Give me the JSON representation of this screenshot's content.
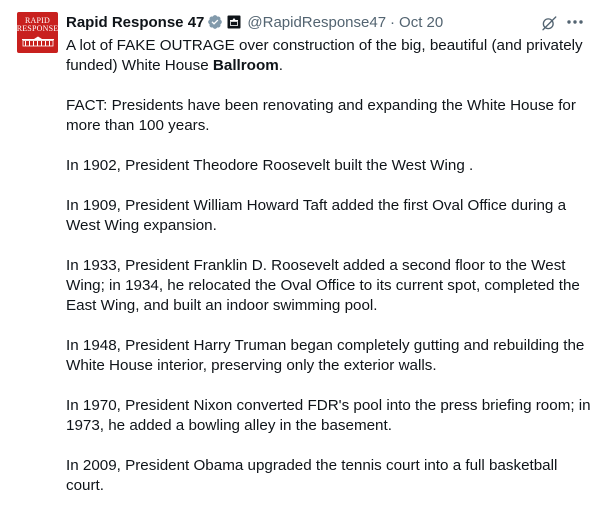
{
  "post": {
    "avatar_text_line1": "RAPID",
    "avatar_text_line2": "RESPONSE",
    "display_name": "Rapid Response 47",
    "handle": "@RapidResponse47",
    "separator": "·",
    "date": "Oct 20",
    "intro_text": "A lot of FAKE OUTRAGE over construction of the big, beautiful (and privately funded) White House ",
    "intro_bold": "Ballroom",
    "intro_end": ".",
    "paragraphs": [
      "FACT: Presidents have been renovating and expanding the White House for more than 100 years.",
      "In 1902, President Theodore Roosevelt built the West Wing .",
      "In 1909, President William Howard Taft added the first Oval Office during a West Wing expansion.",
      "In 1933, President Franklin D. Roosevelt added a second floor to the West Wing; in 1934, he relocated the Oval Office to its current spot, completed the East Wing, and built an indoor swimming pool.",
      "In 1948, President Harry Truman began completely gutting and rebuilding the White House interior, preserving only the exterior walls.",
      "In 1970, President Nixon converted FDR's pool into the press briefing room; in 1973, he added a bowling alley in the basement.",
      "In 2009, President Obama upgraded the tennis court into a full basketball court."
    ]
  },
  "icons": {
    "verified": "verified-badge-icon",
    "affiliate": "affiliate-badge-icon",
    "grok": "grok-icon",
    "more": "more-options-icon"
  },
  "colors": {
    "avatar_bg": "#c8201e",
    "verified": "#829aab",
    "secondary_text": "#536471"
  }
}
